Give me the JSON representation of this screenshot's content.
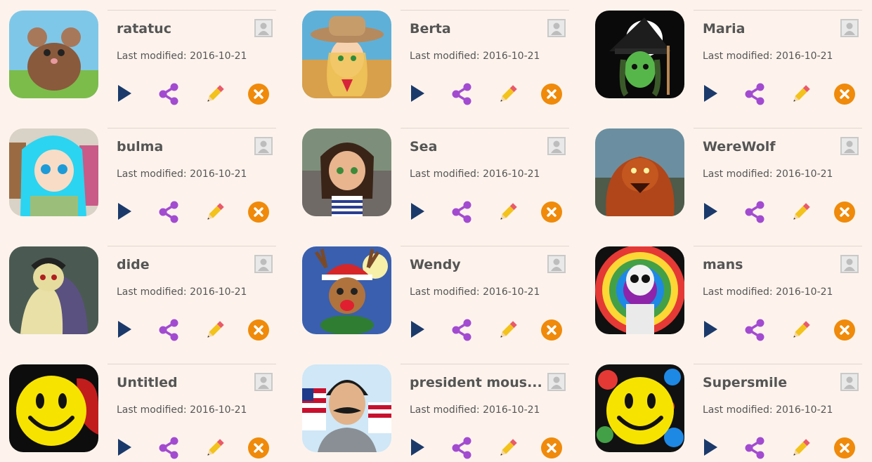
{
  "labels": {
    "last_modified_prefix": "Last modified:"
  },
  "colors": {
    "play": "#1b3a6b",
    "share": "#a24bd1",
    "delete": "#f08a0a",
    "divider": "#e1d7cf"
  },
  "items": [
    {
      "title": "ratatuc",
      "modified": "2016-10-21",
      "thumb": "rat"
    },
    {
      "title": "Berta",
      "modified": "2016-10-21",
      "thumb": "cowgirl"
    },
    {
      "title": "Maria",
      "modified": "2016-10-21",
      "thumb": "witch"
    },
    {
      "title": "bulma",
      "modified": "2016-10-21",
      "thumb": "anime-girl"
    },
    {
      "title": "Sea",
      "modified": "2016-10-21",
      "thumb": "girl"
    },
    {
      "title": "WereWolf",
      "modified": "2016-10-21",
      "thumb": "werewolf"
    },
    {
      "title": "dide",
      "modified": "2016-10-21",
      "thumb": "zombie"
    },
    {
      "title": "Wendy",
      "modified": "2016-10-21",
      "thumb": "reindeer"
    },
    {
      "title": "mans",
      "modified": "2016-10-21",
      "thumb": "skeleton"
    },
    {
      "title": "Untitled",
      "modified": "2016-10-21",
      "thumb": "smiley"
    },
    {
      "title": "president mous...",
      "modified": "2016-10-21",
      "thumb": "mustache-man"
    },
    {
      "title": "Supersmile",
      "modified": "2016-10-21",
      "thumb": "smiley-splash"
    }
  ]
}
